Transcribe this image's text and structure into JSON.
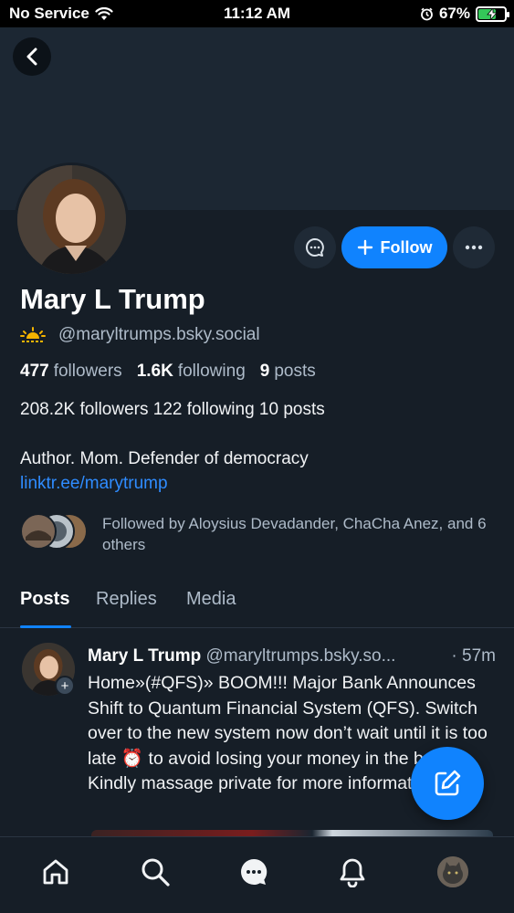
{
  "status_bar": {
    "carrier": "No Service",
    "time": "11:12 AM",
    "battery_percent": "67%",
    "battery_level": 0.67
  },
  "profile": {
    "name": "Mary L Trump",
    "handle": "@maryltrumps.bsky.social",
    "follow_label": "Follow",
    "stats": {
      "followers_count": "477",
      "followers_label": "followers",
      "following_count": "1.6K",
      "following_label": "following",
      "posts_count": "9",
      "posts_label": "posts"
    },
    "bio_stats": "208.2K followers 122 following 10 posts",
    "bio": "Author. Mom. Defender of democracy",
    "link": "linktr.ee/marytrump",
    "followed_by": "Followed by Aloysius Devadander, ChaCha Anez, and 6 others"
  },
  "tabs": [
    {
      "label": "Posts",
      "active": true
    },
    {
      "label": "Replies",
      "active": false
    },
    {
      "label": "Media",
      "active": false
    }
  ],
  "post": {
    "author": "Mary L Trump",
    "handle": "@maryltrumps.bsky.so...",
    "time": "· 57m",
    "text": "Home»(#QFS)» BOOM!!! Major Bank Announces Shift to Quantum Financial System (QFS). Switch over to the new system now don’t wait until it is too late ⏰ to avoid losing your money in the bank..! Kindly massage private for more information‼️⚠️"
  },
  "colors": {
    "background": "#161e27",
    "banner": "#1c2733",
    "accent": "#1083fe",
    "muted_text": "#aebbc9"
  },
  "icons": {
    "back": "chevron-left-icon",
    "message": "chat-bubble-icon",
    "more": "more-horizontal-icon",
    "compose": "compose-icon",
    "home": "home-icon",
    "search": "search-icon",
    "chat": "chat-icon",
    "notifications": "bell-icon"
  }
}
